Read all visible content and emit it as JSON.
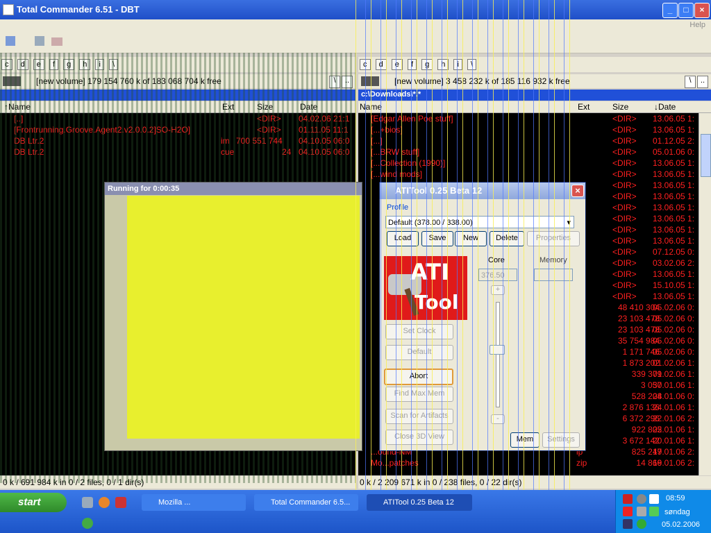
{
  "window": {
    "title": "Total Commander 6.51 - DBT",
    "help_menu": "Help"
  },
  "left_panel": {
    "drives": [
      "c",
      "d",
      "e",
      "f",
      "g",
      "h",
      "i",
      "\\"
    ],
    "volume_info": "[new volume]  179 154 760 k of 183 068 704 k free",
    "path": "",
    "columns": {
      "name": "↑Name",
      "ext": "Ext",
      "size": "Size",
      "date": "Date"
    },
    "rows": [
      {
        "name": "[..]",
        "ext": "",
        "size": "<DIR>",
        "date": "04.02.06 21:1"
      },
      {
        "name": "[Frontrunning.Groove.Agent2.v2.0.0.2]SO-H2O]",
        "ext": "",
        "size": "<DIR>",
        "date": "01.11.05 11:1"
      },
      {
        "name": "DB Ltr.2",
        "ext": "im",
        "size": "700 551 744",
        "date": "04.10.05 06:0"
      },
      {
        "name": "DB Ltr.2",
        "ext": "cue",
        "size": "24",
        "date": "04.10.05 06:0"
      }
    ],
    "status": "0 k / 691 984 k in 0 / 2 files, 0 / 1 dir(s)"
  },
  "right_panel": {
    "drives": [
      "c",
      "d",
      "e",
      "f",
      "g",
      "h",
      "i",
      "\\"
    ],
    "volume_info": "[new volume]  3 458 232 k of 185 116 932 k free",
    "path": "c:\\Downloads\\*.*",
    "columns": {
      "name": "Name",
      "ext": "Ext",
      "size": "Size",
      "date": "↓Date"
    },
    "rows": [
      {
        "name": "[Edgar Allen Poe stuff]",
        "ext": "",
        "size": "<DIR>",
        "date": "13.06.05 1:"
      },
      {
        "name": "[...+bios]",
        "ext": "",
        "size": "<DIR>",
        "date": "13.06.05 1:"
      },
      {
        "name": "[...]",
        "ext": "",
        "size": "<DIR>",
        "date": "01.12.05 2:"
      },
      {
        "name": "[...BRW stuff]",
        "ext": "",
        "size": "<DIR>",
        "date": "05.01.06 0:"
      },
      {
        "name": "[...Collection (1990)]",
        "ext": "",
        "size": "<DIR>",
        "date": "13.06.05 1:"
      },
      {
        "name": "[...wind mods]",
        "ext": "",
        "size": "<DIR>",
        "date": "13.06.05 1:"
      },
      {
        "name": "",
        "ext": "",
        "size": "<DIR>",
        "date": "13.06.05 1:"
      },
      {
        "name": "",
        "ext": "",
        "size": "<DIR>",
        "date": "13.06.05 1:"
      },
      {
        "name": "",
        "ext": "",
        "size": "<DIR>",
        "date": "13.06.05 1:"
      },
      {
        "name": "",
        "ext": "",
        "size": "<DIR>",
        "date": "13.06.05 1:"
      },
      {
        "name": "",
        "ext": "",
        "size": "<DIR>",
        "date": "13.06.05 1:"
      },
      {
        "name": "",
        "ext": "",
        "size": "<DIR>",
        "date": "13.06.05 1:"
      },
      {
        "name": "",
        "ext": "",
        "size": "<DIR>",
        "date": "07.12.05 0:"
      },
      {
        "name": "",
        "ext": "",
        "size": "<DIR>",
        "date": "03.02.06 2:"
      },
      {
        "name": "",
        "ext": "",
        "size": "<DIR>",
        "date": "13.06.05 1:"
      },
      {
        "name": "",
        "ext": "",
        "size": "<DIR>",
        "date": "15.10.05 1:"
      },
      {
        "name": "",
        "ext": "",
        "size": "<DIR>",
        "date": "13.06.05 1:"
      },
      {
        "name": "",
        "ext": "e",
        "size": "48 410 304",
        "date": "05.02.06 0:"
      },
      {
        "name": "",
        "ext": "e",
        "size": "23 103 478",
        "date": "05.02.06 0:"
      },
      {
        "name": "",
        "ext": "e",
        "size": "23 103 478",
        "date": "05.02.06 0:"
      },
      {
        "name": "",
        "ext": "e",
        "size": "35 754 984",
        "date": "05.02.06 0:"
      },
      {
        "name": "",
        "ext": "e",
        "size": "1 171 746",
        "date": "05.02.06 0:"
      },
      {
        "name": "",
        "ext": "e",
        "size": "1 873 202",
        "date": "01.02.06 1:"
      },
      {
        "name": "",
        "ext": "e",
        "size": "339 379",
        "date": "01.02.06 1:"
      },
      {
        "name": "",
        "ext": "",
        "size": "3 057",
        "date": "30.01.06 1:"
      },
      {
        "name": "",
        "ext": "",
        "size": "528 204",
        "date": "28.01.06 0:"
      },
      {
        "name": "",
        "ext": "e",
        "size": "2 876 136",
        "date": "24.01.06 1:"
      },
      {
        "name": "",
        "ext": "e",
        "size": "6 372 296",
        "date": "22.01.06 2:"
      },
      {
        "name": "",
        "ext": "e",
        "size": "922 805",
        "date": "22.01.06 1:"
      },
      {
        "name": "",
        "ext": "e",
        "size": "3 672 142",
        "date": "20.01.06 1:"
      },
      {
        "name": "...ound-NM",
        "ext": "ip",
        "size": "825 247",
        "date": "19.01.06 2:"
      },
      {
        "name": "Mo...patches",
        "ext": "zip",
        "size": "14 866",
        "date": "19.01.06 2:"
      }
    ],
    "status": "0 k / 2 209 671 k in 0 / 238 files, 0 / 22 dir(s)"
  },
  "running_dialog": {
    "title": "Running for 0:00:35"
  },
  "atitool": {
    "title": "ATITool 0.25 Beta 12",
    "profile_label": "Profile",
    "profile_value": "Default (378.00 / 338.00)",
    "buttons": {
      "load": "Load",
      "save": "Save",
      "new": "New",
      "delete": "Delete",
      "properties": "Properties",
      "set_clock": "Set Clock",
      "default": "Default",
      "abort": "Abort",
      "find_max_mem": "Find Max Mem",
      "scan_artifacts": "Scan for Artifacts",
      "close_3d": "Close 3D View",
      "mem": "Mem",
      "settings": "Settings"
    },
    "core_label": "Core",
    "core_value": "376.50",
    "memory_label": "Memory",
    "memory_value": "",
    "plus": "+",
    "minus": "-",
    "logo_ati": "ATI",
    "logo_tool": "Tool",
    "core_slider_level": 0.55
  },
  "taskbar": {
    "start_label": "start",
    "tasks": [
      {
        "label": "Mozilla ..."
      },
      {
        "label": "Total Commander 6.5..."
      },
      {
        "label": "ATITool 0.25 Beta 12"
      }
    ],
    "clock_time": "08:59",
    "clock_day": "søndag",
    "clock_date": "05.02.2006"
  },
  "colors": {
    "file_red": "#ff2020",
    "panel_bg": "#000000",
    "path_blue": "#2050d8",
    "glitch_yellow": "#e8ef2e"
  }
}
